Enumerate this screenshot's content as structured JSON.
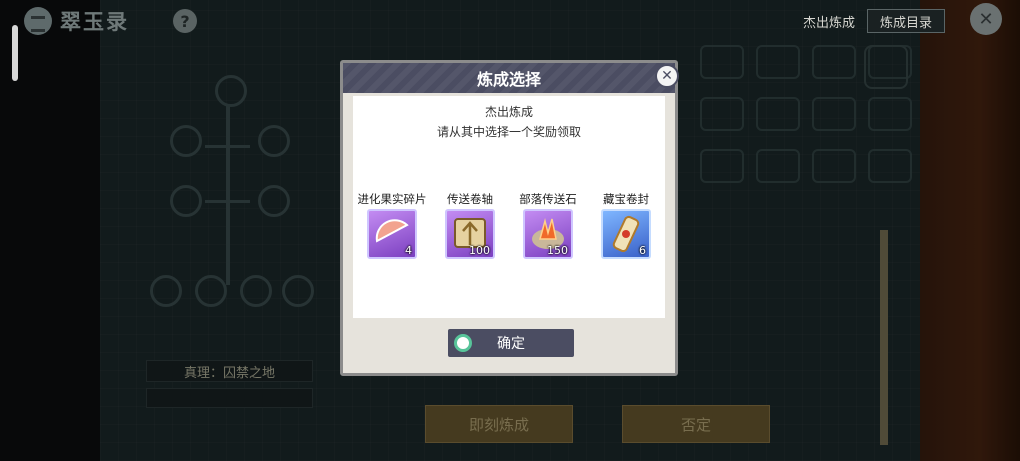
{
  "app": {
    "title": "翠玉录",
    "help_label": "?"
  },
  "top": {
    "outstanding_label": "杰出炼成",
    "catalog_label": "炼成目录",
    "close_glyph": "✕"
  },
  "board": {
    "truth_label": "真理：囚禁之地",
    "instant_button": "即刻炼成",
    "deny_button": "否定"
  },
  "dialog": {
    "title": "炼成选择",
    "close_glyph": "✕",
    "heading": "杰出炼成",
    "instruction": "请从其中选择一个奖励领取",
    "rewards": [
      {
        "name": "进化果实碎片",
        "count": "4",
        "icon": "fruit-fragment-icon",
        "color": "#9b5ad8"
      },
      {
        "name": "传送卷轴",
        "count": "100",
        "icon": "teleport-scroll-icon",
        "color": "#9b5ad8"
      },
      {
        "name": "部落传送石",
        "count": "150",
        "icon": "tribe-stone-icon",
        "color": "#9b5ad8"
      },
      {
        "name": "藏宝卷封",
        "count": "6",
        "icon": "treasure-scroll-icon",
        "color": "#4f80e0"
      }
    ],
    "confirm_label": "确定"
  },
  "colors": {
    "accent": "#4b4d62",
    "confirm_ring": "#58c49a"
  }
}
